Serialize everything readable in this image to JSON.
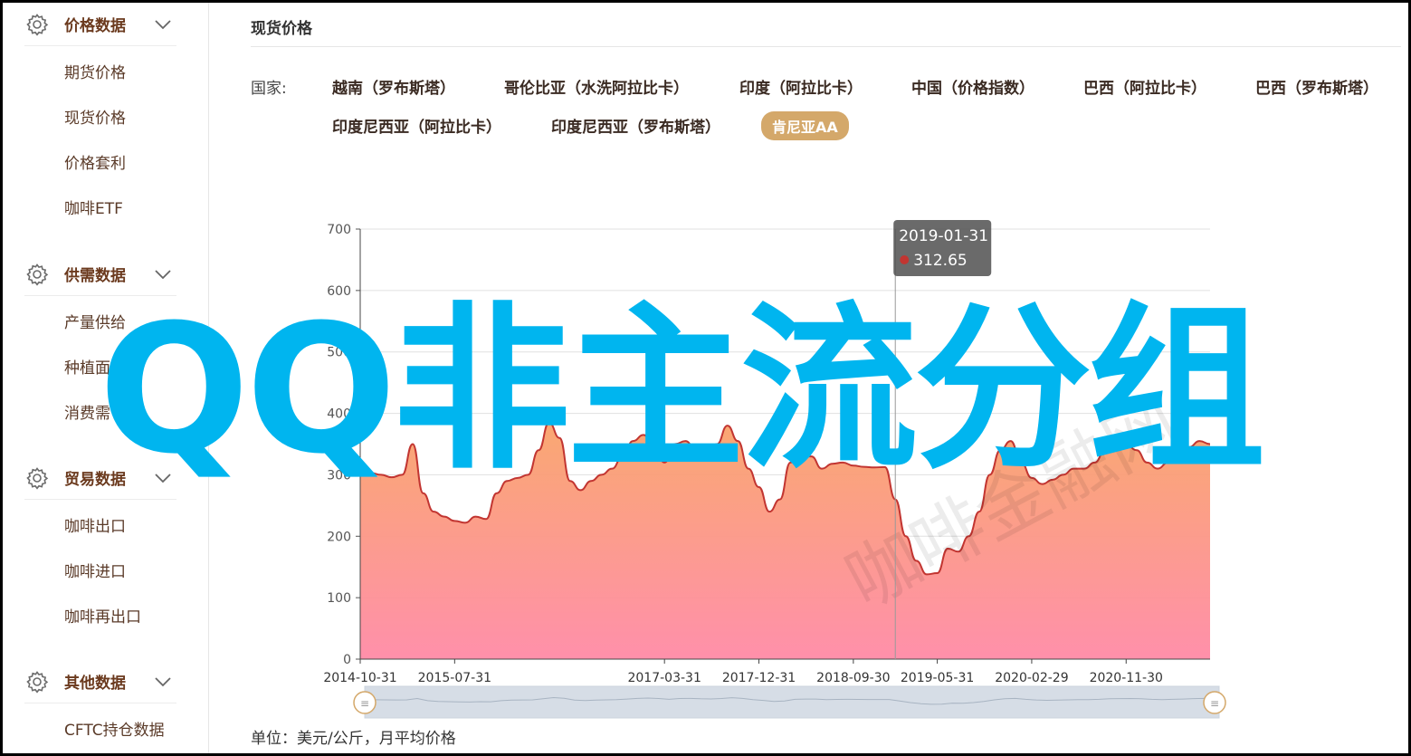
{
  "sidebar": {
    "groups": [
      {
        "title": "价格数据",
        "icon": "gear-icon",
        "items": [
          "期货价格",
          "现货价格",
          "价格套利",
          "咖啡ETF"
        ]
      },
      {
        "title": "供需数据",
        "icon": "gear-icon",
        "items": [
          "产量供给",
          "种植面",
          "消费需"
        ]
      },
      {
        "title": "贸易数据",
        "icon": "gear-icon",
        "items": [
          "咖啡出口",
          "咖啡进口",
          "咖啡再出口"
        ]
      },
      {
        "title": "其他数据",
        "icon": "gear-icon",
        "items": [
          "CFTC持仓数据"
        ]
      }
    ]
  },
  "main": {
    "title": "现货价格",
    "country_label": "国家:",
    "countries": [
      "越南（罗布斯塔）",
      "哥伦比亚（水洗阿拉比卡）",
      "印度（阿拉比卡）",
      "中国（价格指数）",
      "巴西（阿拉比卡）",
      "巴西（罗布斯塔）",
      "印度尼西亚（阿拉比卡）",
      "印度尼西亚（罗布斯塔）",
      "肯尼亚AA"
    ],
    "active_country": "肯尼亚AA",
    "unit": "单位：美元/公斤，月平均价格"
  },
  "tooltip": {
    "date": "2019-01-31",
    "value": "312.65"
  },
  "watermark": "咖啡金融网",
  "overlay_text": "QQ非主流分组",
  "colors": {
    "accent": "#d4a86a",
    "line": "#c23531",
    "area_top": "#f9a36a",
    "area_bottom": "#ff8aa6",
    "overlay": "#00b5ef"
  },
  "chart_data": {
    "type": "area",
    "title": "",
    "xlabel": "",
    "ylabel": "",
    "ylim": [
      0,
      700
    ],
    "yticks": [
      0,
      100,
      200,
      300,
      400,
      500,
      600,
      700
    ],
    "xticks": [
      "2014-10-31",
      "2015-07-31",
      "2017-03-31",
      "2017-12-31",
      "2018-09-30",
      "2019-05-31",
      "2020-02-29",
      "2020-11-30"
    ],
    "x": [
      "2014-10",
      "2014-11",
      "2014-12",
      "2015-01",
      "2015-02",
      "2015-03",
      "2015-04",
      "2015-05",
      "2015-06",
      "2015-07",
      "2015-08",
      "2015-09",
      "2015-10",
      "2015-11",
      "2015-12",
      "2016-01",
      "2016-02",
      "2016-03",
      "2016-04",
      "2016-05",
      "2016-06",
      "2016-07",
      "2016-08",
      "2016-09",
      "2016-10",
      "2016-11",
      "2016-12",
      "2017-01",
      "2017-02",
      "2017-03",
      "2017-04",
      "2017-05",
      "2017-06",
      "2017-07",
      "2017-08",
      "2017-09",
      "2017-10",
      "2017-11",
      "2017-12",
      "2018-01",
      "2018-02",
      "2018-03",
      "2018-04",
      "2018-05",
      "2018-06",
      "2018-07",
      "2018-08",
      "2018-09",
      "2018-10",
      "2018-11",
      "2018-12",
      "2019-01",
      "2019-02",
      "2019-03",
      "2019-04",
      "2019-05",
      "2019-06",
      "2019-07",
      "2019-08",
      "2019-09",
      "2019-10",
      "2019-11",
      "2019-12",
      "2020-01",
      "2020-02",
      "2020-03",
      "2020-04",
      "2020-05",
      "2020-06",
      "2020-07",
      "2020-08",
      "2020-09",
      "2020-10",
      "2020-11",
      "2020-12",
      "2021-01",
      "2021-02",
      "2021-03",
      "2021-04",
      "2021-05",
      "2021-06",
      "2021-07"
    ],
    "series": [
      {
        "values": [
          310,
          303,
          300,
          296,
          300,
          350,
          270,
          240,
          232,
          225,
          222,
          232,
          228,
          270,
          290,
          295,
          300,
          340,
          385,
          360,
          290,
          275,
          290,
          300,
          310,
          330,
          355,
          365,
          348,
          320,
          350,
          355,
          340,
          335,
          350,
          380,
          355,
          310,
          280,
          240,
          260,
          320,
          330,
          330,
          310,
          318,
          320,
          315,
          313,
          312,
          312.65,
          260,
          200,
          160,
          138,
          140,
          180,
          175,
          200,
          240,
          300,
          340,
          355,
          320,
          295,
          285,
          292,
          300,
          310,
          310,
          320,
          340,
          345,
          350,
          340,
          320,
          310,
          320,
          330,
          345,
          355,
          350
        ]
      }
    ]
  },
  "dataZoom": {
    "start_label": "≡",
    "end_label": "≡"
  }
}
